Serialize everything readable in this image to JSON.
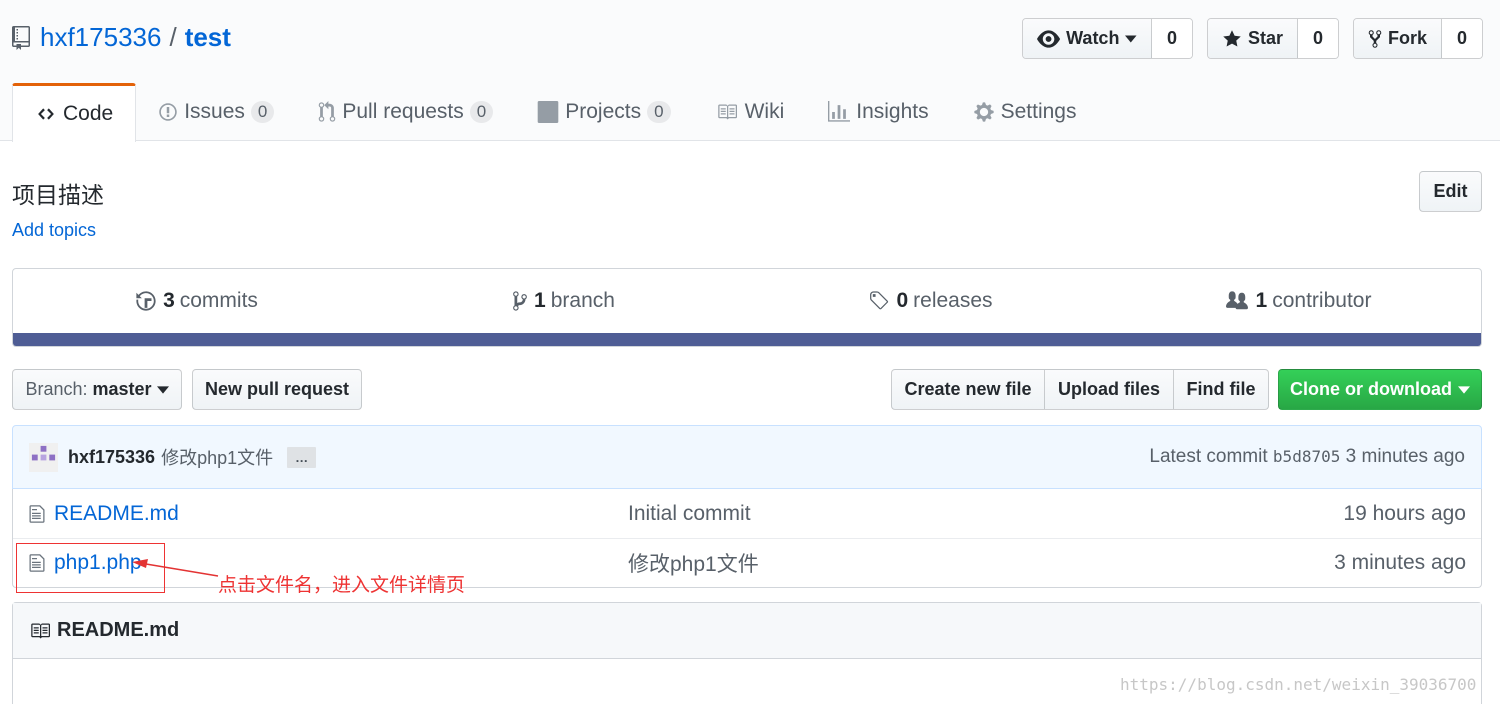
{
  "repo": {
    "owner": "hxf175336",
    "separator": "/",
    "name": "test"
  },
  "actions": {
    "watch": {
      "label": "Watch",
      "count": "0"
    },
    "star": {
      "label": "Star",
      "count": "0"
    },
    "fork": {
      "label": "Fork",
      "count": "0"
    }
  },
  "tabs": [
    {
      "label": "Code",
      "icon": "code-icon",
      "selected": true
    },
    {
      "label": "Issues",
      "counter": "0",
      "icon": "issue-icon"
    },
    {
      "label": "Pull requests",
      "counter": "0",
      "icon": "pull-request-icon"
    },
    {
      "label": "Projects",
      "counter": "0",
      "icon": "project-icon"
    },
    {
      "label": "Wiki",
      "icon": "book-icon"
    },
    {
      "label": "Insights",
      "icon": "graph-icon"
    },
    {
      "label": "Settings",
      "icon": "gear-icon"
    }
  ],
  "description": {
    "text": "项目描述",
    "add_topics": "Add topics",
    "edit_label": "Edit"
  },
  "summary": {
    "commits": {
      "num": "3",
      "label": "commits"
    },
    "branches": {
      "num": "1",
      "label": "branch"
    },
    "releases": {
      "num": "0",
      "label": "releases"
    },
    "contributors": {
      "num": "1",
      "label": "contributor"
    },
    "language_color": "#4f5d95"
  },
  "file_nav": {
    "branch_prefix": "Branch:",
    "branch_name": "master",
    "new_pr": "New pull request",
    "create_file": "Create new file",
    "upload": "Upload files",
    "find": "Find file",
    "clone": "Clone or download"
  },
  "commit": {
    "author": "hxf175336",
    "message": "修改php1文件",
    "ellipsis": "…",
    "latest_label": "Latest commit",
    "sha": "b5d8705",
    "age": "3 minutes ago"
  },
  "files": [
    {
      "name": "README.md",
      "message": "Initial commit",
      "age": "19 hours ago"
    },
    {
      "name": "php1.php",
      "message": "修改php1文件",
      "age": "3 minutes ago"
    }
  ],
  "readme": {
    "title": "README.md"
  },
  "annotation": {
    "text": "点击文件名，进入文件详情页",
    "color": "#e33333"
  },
  "watermark": "https://blog.csdn.net/weixin_39036700",
  "colors": {
    "link": "#0366d6",
    "tab_accent": "#e36209",
    "clone_green": "#28a745"
  }
}
